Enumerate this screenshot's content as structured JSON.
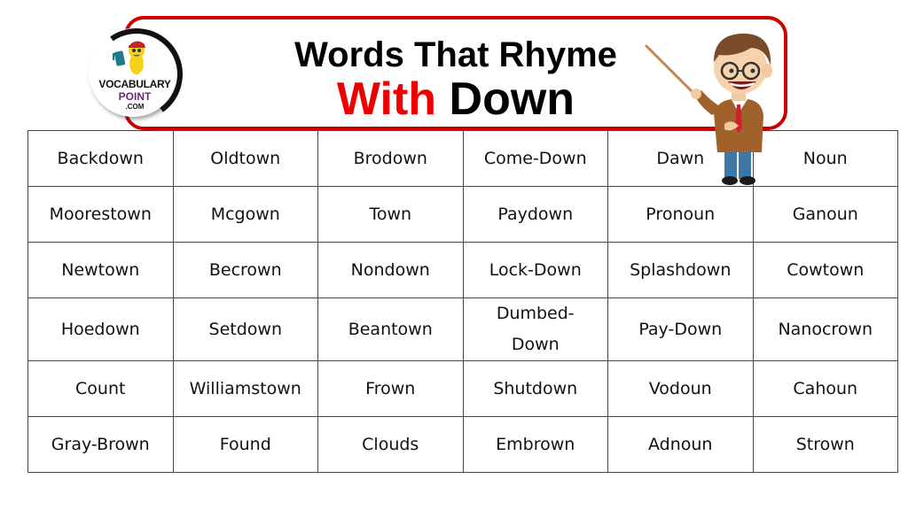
{
  "header": {
    "title_line1": "Words That Rhyme",
    "title_word_with": "With",
    "title_word_down": "Down",
    "accent_color": "#ee0000",
    "border_color": "#cc0000"
  },
  "logo": {
    "line1": "VOCABULARY",
    "line2": "POINT",
    "line3": ".COM"
  },
  "table": {
    "rows": [
      [
        "Backdown",
        "Oldtown",
        "Brodown",
        "Come-Down",
        "Dawn",
        "Noun"
      ],
      [
        "Moorestown",
        "Mcgown",
        "Town",
        "Paydown",
        "Pronoun",
        "Ganoun"
      ],
      [
        "Newtown",
        "Becrown",
        "Nondown",
        "Lock-Down",
        "Splashdown",
        "Cowtown"
      ],
      [
        "Hoedown",
        "Setdown",
        "Beantown",
        "Dumbed-Down",
        "Pay-Down",
        "Nanocrown"
      ],
      [
        "Count",
        "Williamstown",
        "Frown",
        "Shutdown",
        "Vodoun",
        "Cahoun"
      ],
      [
        "Gray-Brown",
        "Found",
        "Clouds",
        "Embrown",
        "Adnoun",
        "Strown"
      ]
    ]
  },
  "illustrations": {
    "mascot": "teacher-with-pointer-icon",
    "logo_mascot": "yellow-mascot-with-book-icon"
  }
}
